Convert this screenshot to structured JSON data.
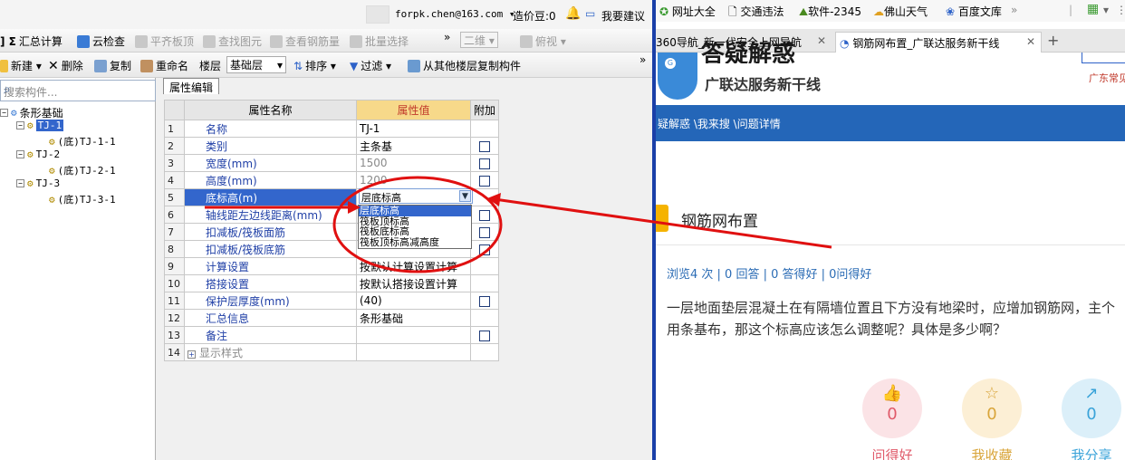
{
  "titlebar": {
    "email": "forpk.chen@163.com ▾",
    "price_beans": "造价豆:0",
    "feedback": "我要建议"
  },
  "toolbar1": {
    "items": [
      "汇总计算",
      "云检查",
      "平齐板顶",
      "查找图元",
      "查看钢筋量",
      "批量选择",
      "»",
      "二维 ▾",
      "俯视 ▾"
    ]
  },
  "toolbar2": {
    "items": [
      "新建 ▾",
      "删除",
      "复制",
      "重命名",
      "楼层",
      "基础层",
      "▾",
      "排序 ▾",
      "过滤 ▾",
      "从其他楼层复制构件",
      "»"
    ]
  },
  "search": {
    "placeholder": "搜索构件..."
  },
  "tree": [
    {
      "label": "条形基础"
    },
    {
      "label": "TJ-1"
    },
    {
      "label": "(底)TJ-1-1"
    },
    {
      "label": "TJ-2"
    },
    {
      "label": "(底)TJ-2-1"
    },
    {
      "label": "TJ-3"
    },
    {
      "label": "(底)TJ-3-1"
    }
  ],
  "props": {
    "tab": "属性编辑",
    "headers": [
      "属性名称",
      "属性值",
      "附加"
    ],
    "rows": [
      {
        "n": "1",
        "name": "名称",
        "value": "TJ-1"
      },
      {
        "n": "2",
        "name": "类别",
        "value": "主条基"
      },
      {
        "n": "3",
        "name": "宽度(mm)",
        "value": "1500"
      },
      {
        "n": "4",
        "name": "高度(mm)",
        "value": "1200"
      },
      {
        "n": "5",
        "name": "底标高(m)",
        "value": "层底标高"
      },
      {
        "n": "6",
        "name": "轴线距左边线距离(mm)",
        "value": ""
      },
      {
        "n": "7",
        "name": "扣减板/筏板面筋",
        "value": ""
      },
      {
        "n": "8",
        "name": "扣减板/筏板底筋",
        "value": ""
      },
      {
        "n": "9",
        "name": "计算设置",
        "value": "按默认计算设置计算"
      },
      {
        "n": "10",
        "name": "搭接设置",
        "value": "按默认搭接设置计算"
      },
      {
        "n": "11",
        "name": "保护层厚度(mm)",
        "value": "(40)"
      },
      {
        "n": "12",
        "name": "汇总信息",
        "value": "条形基础"
      },
      {
        "n": "13",
        "name": "备注",
        "value": ""
      },
      {
        "n": "14",
        "name": "显示样式",
        "value": ""
      }
    ],
    "dropdown_options": [
      "层底标高",
      "筏板顶标高",
      "筏板底标高",
      "筏板顶标高减高度"
    ]
  },
  "browser": {
    "bookmarks": [
      "网址大全",
      "交通违法",
      "软件-2345",
      "佛山天气",
      "百度文库",
      "»"
    ],
    "tabs": [
      "360导航_新一代安全上网导航",
      "钢筋网布置_广联达服务新干线",
      "+"
    ],
    "logo_big": "答疑解惑",
    "logo_sub": "广联达服务新干线",
    "region": "广东常见",
    "breadcrumb": "疑解惑 \\我来搜 \\问题详情",
    "question_title": "钢筋网布置",
    "stats": "浏览4 次 | 0 回答 | 0 答得好 | 0问得好",
    "question_body": "一层地面垫层混凝土在有隔墙位置且下方没有地梁时，应增加钢筋网，主个用条基布，那这个标高应该怎么调整呢？具体是多少啊？",
    "actions": [
      {
        "label": "问得好",
        "count": "0",
        "color": "#e05a6a",
        "bg": "#fbe3e6"
      },
      {
        "label": "我收藏",
        "count": "0",
        "color": "#d9a53a",
        "bg": "#fcefd5"
      },
      {
        "label": "我分享",
        "count": "0",
        "color": "#3aa3d9",
        "bg": "#dbeff9"
      }
    ]
  }
}
